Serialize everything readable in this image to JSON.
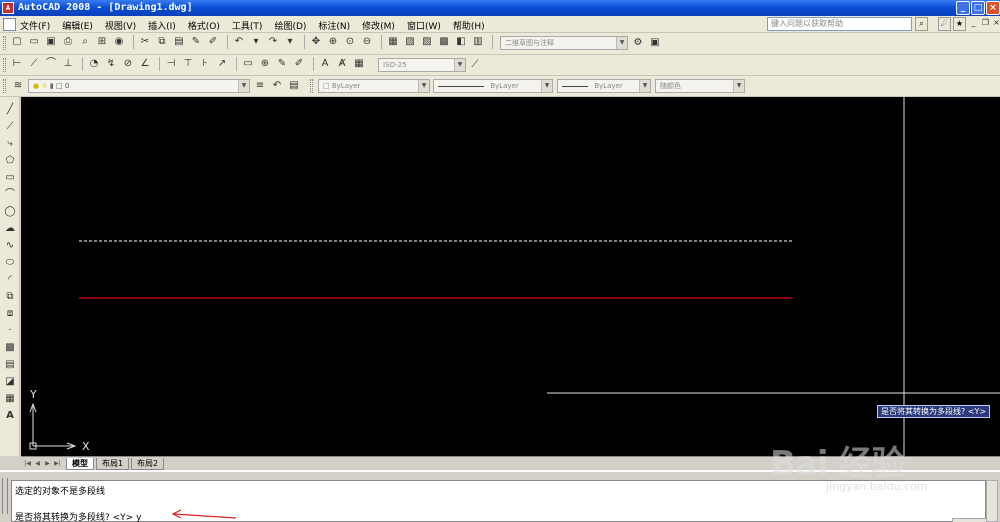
{
  "window": {
    "title": "AutoCAD 2008 - [Drawing1.dwg]",
    "app_icon": "autocad-logo-icon"
  },
  "menu": {
    "items": [
      "文件(F)",
      "编辑(E)",
      "视图(V)",
      "插入(I)",
      "格式(O)",
      "工具(T)",
      "绘图(D)",
      "标注(N)",
      "修改(M)",
      "窗口(W)",
      "帮助(H)"
    ],
    "help_placeholder": "键入问题以获取帮助"
  },
  "toolbars": {
    "workspace_combo": "二维草图与注释",
    "dimstyle_combo": "ISO-25",
    "layer_combo": "0",
    "color_combo": "ByLayer",
    "linetype_combo": "ByLayer",
    "lineweight_combo": "ByLayer",
    "plotstyle_combo": "随颜色"
  },
  "canvas": {
    "background": "#000000",
    "ucs_x_label": "X",
    "ucs_y_label": "Y",
    "red_line_color": "#c00000",
    "dashed_line_color": "#ffffff",
    "tooltip": "是否将其转换为多段线? <Y>"
  },
  "tabs": {
    "model": "模型",
    "layout1": "布局1",
    "layout2": "布局2"
  },
  "command": {
    "line1": "选定的对象不是多段线",
    "line2": "是否将其转换为多段线? <Y> y"
  },
  "watermark": {
    "logo": "Bai 经验",
    "url": "jingyan.baidu.com"
  }
}
